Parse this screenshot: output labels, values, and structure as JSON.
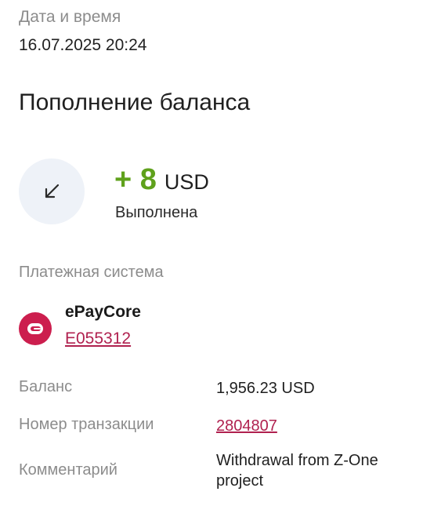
{
  "datetime": {
    "label": "Дата и время",
    "value": "16.07.2025 20:24"
  },
  "title": "Пополнение баланса",
  "operation": {
    "icon": "arrow-down-left-icon",
    "amount": "+ 8",
    "currency": "USD",
    "status": "Выполнена",
    "colors": {
      "amount": "#5fa11c",
      "icon_bg": "#eef2f8"
    }
  },
  "payment_system": {
    "label": "Платежная система",
    "logo_icon": "epaycore-logo-icon",
    "name": "ePayCore",
    "account": "E055312",
    "colors": {
      "logo": "#cc1e4e",
      "link": "#b0214f"
    }
  },
  "details": {
    "balance_label": "Баланс",
    "balance_value": "1,956.23 USD",
    "transaction_label": "Номер транзакции",
    "transaction_value": "2804807",
    "comment_label": "Комментарий",
    "comment_value": "Withdrawal from Z-One project"
  }
}
